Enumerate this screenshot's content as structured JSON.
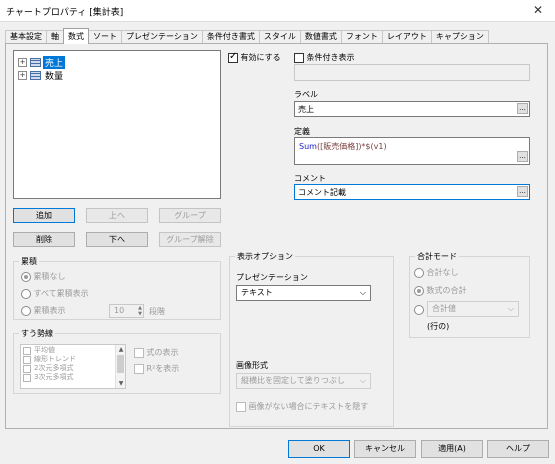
{
  "window": {
    "title": "チャートプロパティ [集計表]",
    "close": "✕"
  },
  "tabs": [
    "基本設定",
    "軸",
    "数式",
    "ソート",
    "プレゼンテーション",
    "条件付き書式",
    "スタイル",
    "数値書式",
    "フォント",
    "レイアウト",
    "キャプション"
  ],
  "tree": {
    "items": [
      {
        "label": "売上",
        "selected": true
      },
      {
        "label": "数量",
        "selected": false
      }
    ]
  },
  "expr_buttons": {
    "add": "追加",
    "up": "上へ",
    "group": "グループ",
    "delete": "削除",
    "down": "下へ",
    "ungroup": "グループ解除"
  },
  "cumulative": {
    "title": "累積",
    "none": "累積なし",
    "all": "すべて累積表示",
    "show": "累積表示",
    "steps_value": "10",
    "steps_label": "段階"
  },
  "trendlines": {
    "title": "すう勢線",
    "items": [
      "平均値",
      "線形トレンド",
      "2次元多項式",
      "3次元多項式"
    ],
    "show_formula": "式の表示",
    "show_r2": "R²を表示"
  },
  "right": {
    "enable": "有効にする",
    "conditional": "条件付き表示",
    "label_caption": "ラベル",
    "label_value": "売上",
    "definition_caption": "定義",
    "definition_func": "Sum",
    "definition_rest": "([販売価格])*$(v1)",
    "comment_caption": "コメント",
    "comment_value": "コメント記載",
    "ellipsis": "..."
  },
  "display_options": {
    "title": "表示オプション",
    "presentation_label": "プレゼンテーション",
    "presentation_value": "テキスト",
    "image_format_label": "画像形式",
    "image_format_value": "縦横比を固定して塗りつぶし",
    "hide_text": "画像がない場合にテキストを隠す"
  },
  "total_mode": {
    "title": "合計モード",
    "none": "合計なし",
    "expr_total": "数式の合計",
    "select_value": "合計値",
    "rows_note": "(行の)"
  },
  "footer": {
    "ok": "OK",
    "cancel": "キャンセル",
    "apply": "適用(A)",
    "help": "ヘルプ"
  }
}
